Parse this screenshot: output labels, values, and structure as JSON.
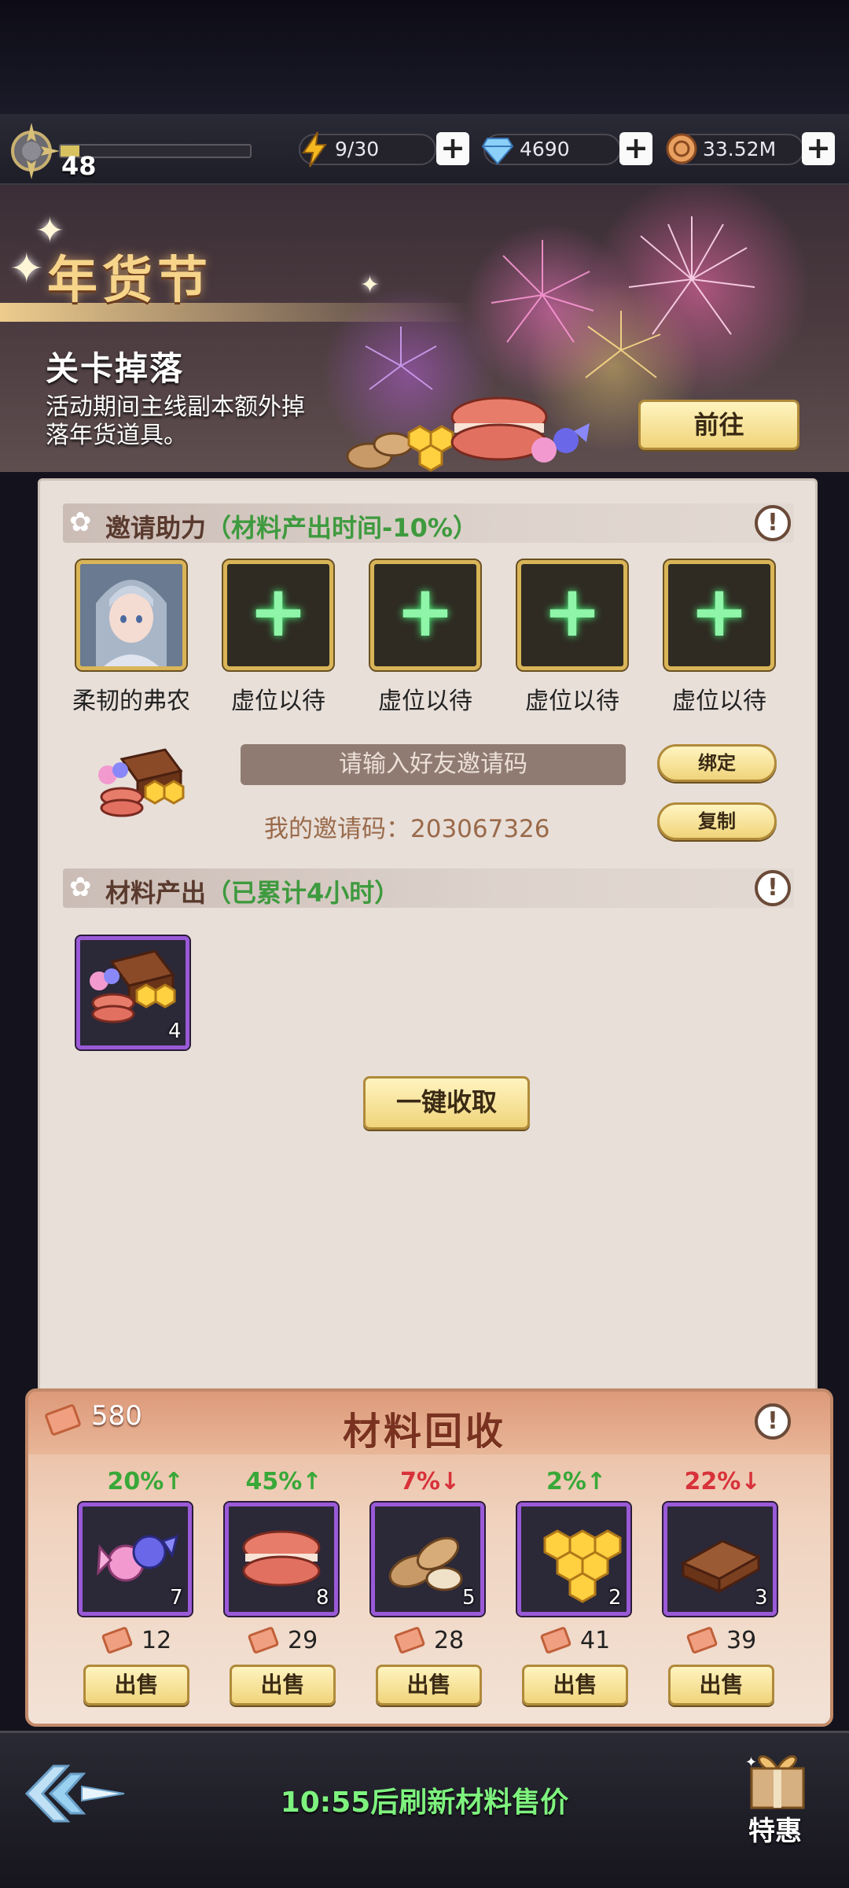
{
  "status_bar": {
    "level": "48",
    "energy": "9/30",
    "diamonds": "4690",
    "gold": "33.52M",
    "exp_progress_fraction": 0.1
  },
  "banner": {
    "title": "年货节",
    "subtitle": "关卡掉落",
    "description": "活动期间主线副本额外掉落年货道具。",
    "go_button": "前往"
  },
  "invite": {
    "section_title": "邀请助力",
    "section_note": "（材料产出时间-10%）",
    "slots": [
      {
        "label": "柔韧的弗农",
        "filled": true
      },
      {
        "label": "虚位以待",
        "filled": false
      },
      {
        "label": "虚位以待",
        "filled": false
      },
      {
        "label": "虚位以待",
        "filled": false
      },
      {
        "label": "虚位以待",
        "filled": false
      }
    ],
    "code_placeholder": "请输入好友邀请码",
    "bind_button": "绑定",
    "copy_button": "复制",
    "my_code": "我的邀请码：203067326"
  },
  "output": {
    "section_title": "材料产出",
    "section_note": "（已累计4小时）",
    "item_count": "4",
    "collect_button": "一键收取"
  },
  "recycle": {
    "title": "材料回收",
    "coupons": "580",
    "items": [
      {
        "name": "candy-icon",
        "change": "20%↑",
        "direction": "up",
        "count": "7",
        "price": "12",
        "sell": "出售"
      },
      {
        "name": "macaron-icon",
        "change": "45%↑",
        "direction": "up",
        "count": "8",
        "price": "29",
        "sell": "出售"
      },
      {
        "name": "almond-icon",
        "change": "7%↓",
        "direction": "down",
        "count": "5",
        "price": "28",
        "sell": "出售"
      },
      {
        "name": "honeycomb-icon",
        "change": "2%↑",
        "direction": "up",
        "count": "2",
        "price": "41",
        "sell": "出售"
      },
      {
        "name": "chocolate-icon",
        "change": "22%↓",
        "direction": "down",
        "count": "3",
        "price": "39",
        "sell": "出售"
      }
    ]
  },
  "bottom": {
    "refresh_text": "10:55后刷新材料售价",
    "special_label": "特惠"
  },
  "colors": {
    "gold_button": "#f0d47a",
    "up_green": "#38a838",
    "down_red": "#d8323a",
    "slot_plus": "#8ff5a8"
  }
}
